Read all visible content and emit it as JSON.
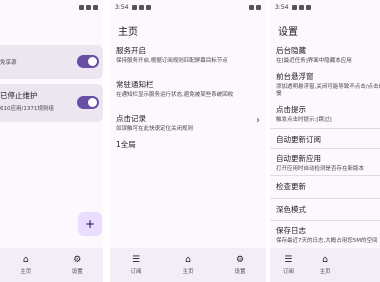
{
  "panel_left": {
    "status_time": "",
    "row1_sub": "免享源",
    "row2_title": "已停止维护",
    "row2_sub": "610应用/1371规则组",
    "fab_label": "+",
    "nav": [
      {
        "icon": "home-icon",
        "glyph": "⌂",
        "label": "主页"
      },
      {
        "icon": "gear-icon",
        "glyph": "⚙",
        "label": "设置"
      }
    ]
  },
  "panel_mid": {
    "status_time": "3:54",
    "title": "主页",
    "service": {
      "title": "服务开启",
      "sub": "保持服务开启,根据订阅规则匹配屏幕目标节点"
    },
    "notify": {
      "title": "常驻通知栏",
      "sub": "在通知栏显示服务运行状态,避免被某些系统回收"
    },
    "records": {
      "title": "点击记录",
      "sub": "如误触可在此快速定位关闭规则",
      "chevron": "›"
    },
    "rule_count": "1全局",
    "nav": [
      {
        "icon": "list-icon",
        "glyph": "☰",
        "label": "订阅"
      },
      {
        "icon": "home-icon",
        "glyph": "⌂",
        "label": "主页"
      },
      {
        "icon": "gear-icon",
        "glyph": "⚙",
        "label": "设置"
      }
    ]
  },
  "panel_right": {
    "status_time": "3:54",
    "title": "设置",
    "items": [
      {
        "title": "后台隐藏",
        "sub": "在[最近任务]界面中隐藏本应用"
      },
      {
        "title": "前台悬浮窗",
        "sub": "添加透明悬浮窗,关闭可能导致不点击/点击缓慢"
      },
      {
        "title": "点击提示",
        "sub": "触发点击时提示:[跳过]"
      },
      {
        "title": "自动更新订阅",
        "sub": ""
      },
      {
        "title": "自动更新应用",
        "sub": "打开应用时自动检测是否存在新版本"
      },
      {
        "title": "检查更新",
        "sub": ""
      },
      {
        "title": "深色模式",
        "sub": ""
      },
      {
        "title": "保存日志",
        "sub": "保存最近7天的日志,大概占用您5M的空间"
      }
    ],
    "nav": [
      {
        "icon": "list-icon",
        "glyph": "☰",
        "label": "订阅"
      },
      {
        "icon": "home-icon",
        "glyph": "⌂",
        "label": "主页"
      },
      {
        "icon": "gear-icon",
        "glyph": "⚙",
        "label": "设置"
      }
    ]
  },
  "colors": {
    "accent": "#6750a4",
    "card": "#ece6f0",
    "navbar": "#f3edf7"
  }
}
